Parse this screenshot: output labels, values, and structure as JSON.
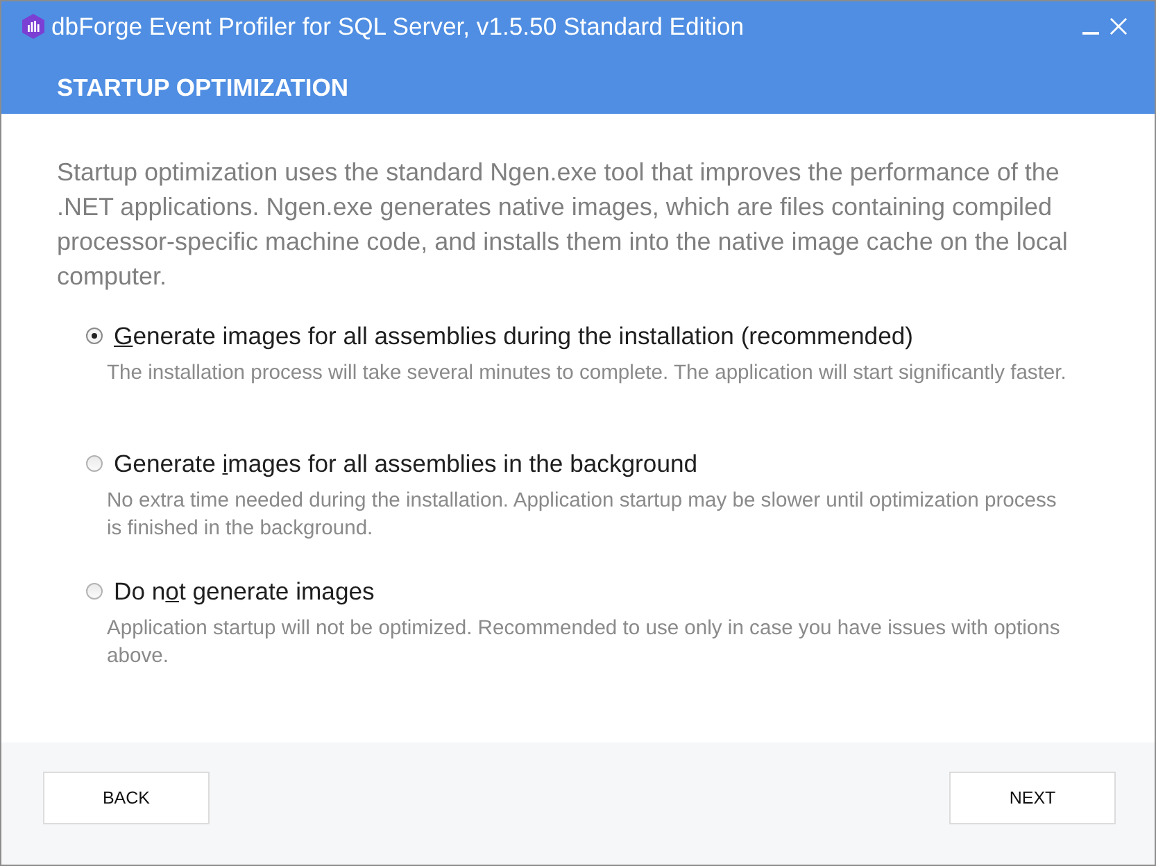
{
  "window": {
    "title": "dbForge Event Profiler for SQL Server, v1.5.50 Standard Edition"
  },
  "header": {
    "title": "STARTUP OPTIMIZATION"
  },
  "intro": "Startup optimization uses the standard Ngen.exe tool that improves the performance of the .NET applications. Ngen.exe generates native images, which are files containing compiled processor-specific machine code, and installs them into the native image cache on the local computer.",
  "options": [
    {
      "access_key": "G",
      "label_after": "enerate images for all assemblies during the installation (recommended)",
      "description": "The installation process will take several minutes to complete. The application will start significantly faster.",
      "selected": true
    },
    {
      "label_before": "Generate ",
      "access_key": "i",
      "label_after": "mages for all assemblies in the background",
      "description": "No extra time needed during the installation. Application startup may be slower until optimization process is finished in the background.",
      "selected": false
    },
    {
      "label_before": "Do n",
      "access_key": "o",
      "label_after": "t generate images",
      "description": "Application startup will not be optimized. Recommended to use only in case you have issues with options above.",
      "selected": false
    }
  ],
  "buttons": [
    "BACK",
    "NEXT"
  ]
}
